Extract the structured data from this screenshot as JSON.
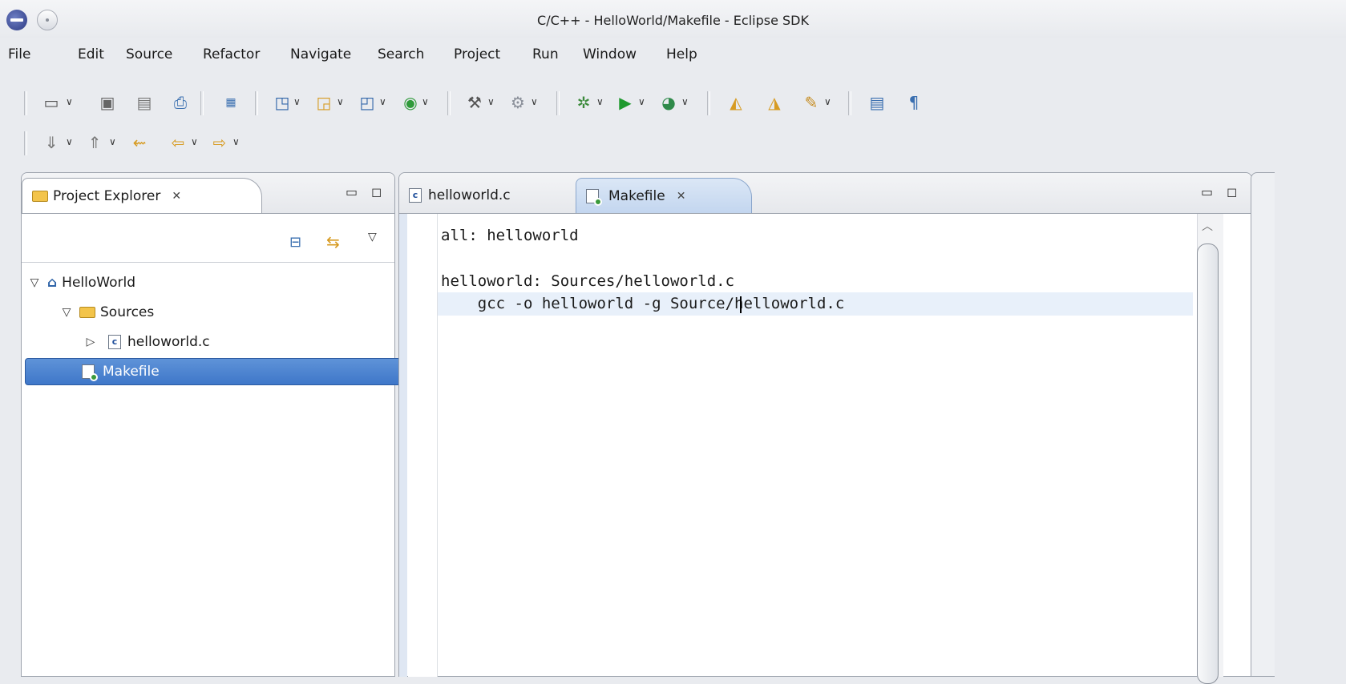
{
  "window": {
    "title": "C/C++ - HelloWorld/Makefile - Eclipse SDK"
  },
  "menu": [
    "File",
    "Edit",
    "Source",
    "Refactor",
    "Navigate",
    "Search",
    "Project",
    "Run",
    "Window",
    "Help"
  ],
  "toolbar": {
    "row1_icons": [
      "new-icon",
      "save-icon",
      "save-all-icon",
      "print-icon",
      "binary-icon",
      "new-cpp-project-icon",
      "new-folder-icon",
      "new-class-icon",
      "new-type-icon",
      "build-icon",
      "build-config-icon",
      "debug-icon",
      "run-icon",
      "external-tools-icon",
      "open-type-icon",
      "open-element-icon",
      "marker-icon",
      "show-whitespace-icon",
      "pilcrow-icon"
    ],
    "row2_icons": [
      "next-annotation-icon",
      "prev-annotation-icon",
      "last-edit-icon",
      "back-icon",
      "forward-icon"
    ]
  },
  "project_explorer": {
    "tab_label": "Project Explorer",
    "tree": [
      {
        "label": "HelloWorld",
        "expanded": true
      },
      {
        "label": "Sources",
        "expanded": true
      },
      {
        "label": "helloworld.c",
        "expanded": false
      },
      {
        "label": "Makefile",
        "selected": true
      }
    ]
  },
  "editor": {
    "tabs": [
      {
        "label": "helloworld.c",
        "active": false
      },
      {
        "label": "Makefile",
        "active": true
      }
    ],
    "lines": [
      "all: helloworld",
      "",
      "helloworld: Sources/helloworld.c",
      "    gcc -o helloworld -g Source/helloworld.c"
    ]
  },
  "colors": {
    "selection": "#3f77c9",
    "current_line": "#e8f0fa",
    "active_tab": "#c3d6ef"
  }
}
